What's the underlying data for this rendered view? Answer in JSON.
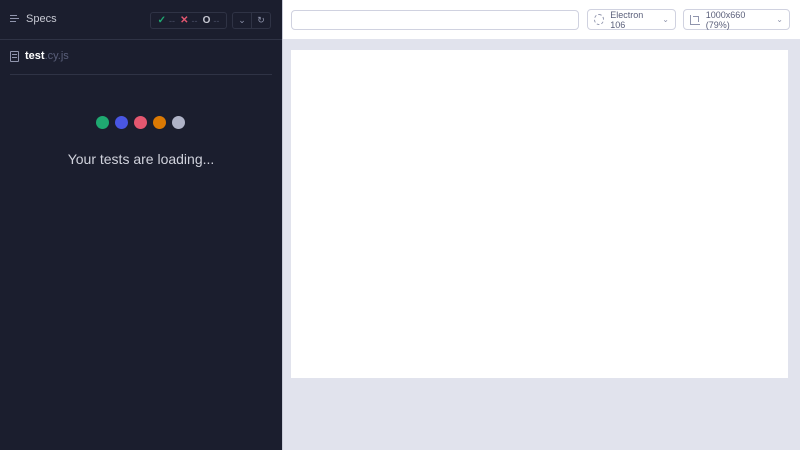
{
  "sidebar": {
    "title": "Specs",
    "stats": {
      "passed_icon": "✓",
      "passed_count": "--",
      "failed_icon": "✕",
      "failed_count": "--",
      "pending_icon": "O",
      "pending_count": "--"
    },
    "controls": {
      "expand_icon": "chevron-down-icon",
      "rerun_icon": "refresh-icon"
    },
    "spec_file": {
      "name": "test",
      "extension": ".cy.js"
    },
    "loading_text": "Your tests are loading...",
    "dot_colors": [
      "#1fa971",
      "#4956e3",
      "#e45770",
      "#db7903",
      "#afb3c7"
    ]
  },
  "toolbar": {
    "url_value": "",
    "browser_label": "Electron 106",
    "viewport_label": "1000x660",
    "zoom_label": "(79%)"
  },
  "colors": {
    "sidebar_bg": "#1b1e2e",
    "pass": "#1fa971",
    "fail": "#e45770",
    "canvas_bg": "#e1e3ed"
  }
}
